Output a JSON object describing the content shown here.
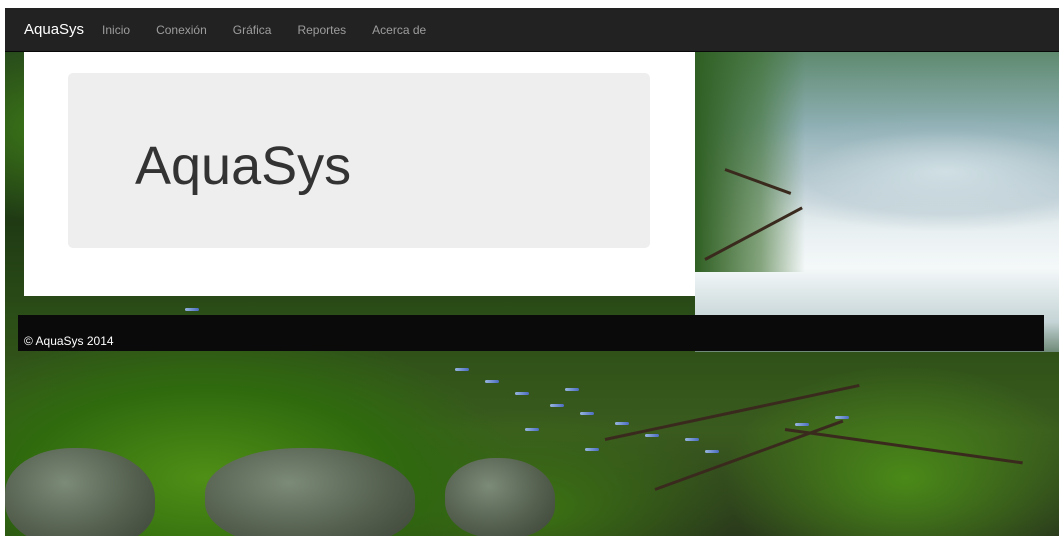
{
  "navbar": {
    "brand": "AquaSys",
    "links": [
      "Inicio",
      "Conexión",
      "Gráfica",
      "Reportes",
      "Acerca de"
    ]
  },
  "jumbotron": {
    "title": "AquaSys"
  },
  "footer": {
    "text": "© AquaSys 2014"
  },
  "theme": {
    "navbar_bg": "#222222",
    "nav_link_color": "#9d9d9d",
    "jumbotron_bg": "#eeeeee",
    "footer_bg": "#0a0a0a"
  }
}
